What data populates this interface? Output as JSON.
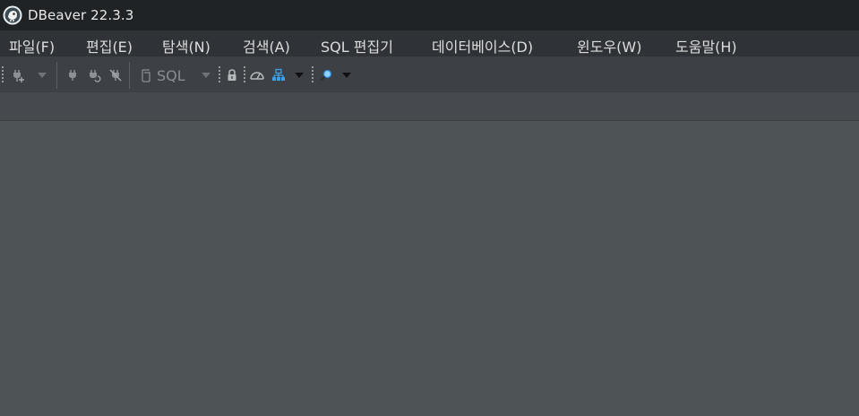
{
  "window": {
    "title": "DBeaver 22.3.3",
    "icon": "dbeaver-beaver-icon"
  },
  "menu": {
    "items": [
      {
        "label": "파일(F)"
      },
      {
        "label": "편집(E)"
      },
      {
        "label": "탐색(N)"
      },
      {
        "label": "검색(A)"
      },
      {
        "label": "SQL 편집기"
      },
      {
        "label": "데이터베이스(D)"
      },
      {
        "label": "윈도우(W)"
      },
      {
        "label": "도움말(H)"
      }
    ]
  },
  "toolbar": {
    "sql_button_label": "SQL",
    "icons": [
      "new-connection-icon",
      "connect-icon",
      "reconnect-icon",
      "disconnect-icon",
      "sql-editor-icon",
      "transaction-lock-icon",
      "dashboard-icon",
      "database-navigator-icon",
      "search-icon"
    ]
  },
  "colors": {
    "titlebar": "#1f2326",
    "menubar": "#2f3338",
    "toolbar": "#3d4145",
    "tabbar": "#46494d",
    "workspace": "#4e5356",
    "accent_blue": "#3aa0e8"
  }
}
